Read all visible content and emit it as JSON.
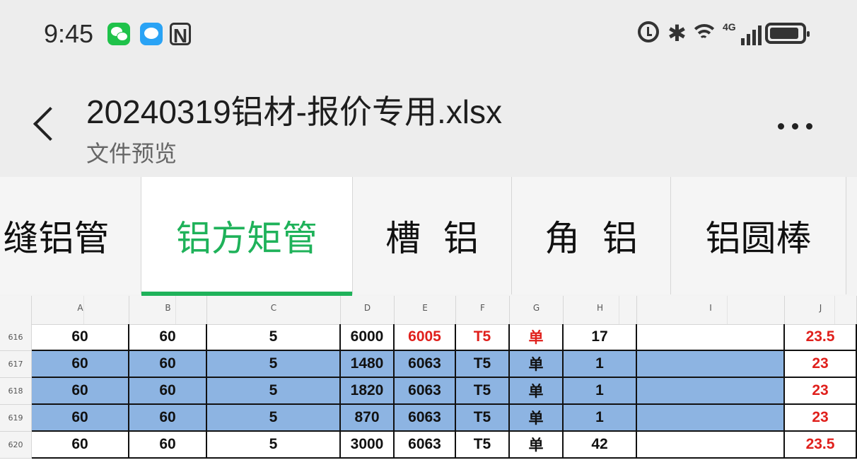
{
  "status_bar": {
    "time": "9:45",
    "network": "4G",
    "icons": [
      "wechat-icon",
      "message-icon",
      "nfc-icon",
      "alarm-icon",
      "bluetooth-icon",
      "wifi-icon",
      "signal-icon",
      "battery-icon"
    ]
  },
  "header": {
    "title": "20240319铝材-报价专用.xlsx",
    "subtitle": "文件预览"
  },
  "tabs": [
    {
      "label": "缝铝管",
      "active": false
    },
    {
      "label": "铝方矩管",
      "active": true
    },
    {
      "label": "槽  铝",
      "active": false
    },
    {
      "label": "角  铝",
      "active": false
    },
    {
      "label": "铝圆棒",
      "active": false
    }
  ],
  "sheet": {
    "columns": [
      "A",
      "B",
      "C",
      "D",
      "E",
      "F",
      "G",
      "H",
      "I",
      "J"
    ],
    "rows": [
      {
        "num": "616",
        "cells": [
          "60",
          "60",
          "5",
          "6000",
          "6005",
          "T5",
          "单",
          "17",
          "",
          "23.5"
        ],
        "highlight": false
      },
      {
        "num": "617",
        "cells": [
          "60",
          "60",
          "5",
          "1480",
          "6063",
          "T5",
          "单",
          "1",
          "",
          "23"
        ],
        "highlight": true
      },
      {
        "num": "618",
        "cells": [
          "60",
          "60",
          "5",
          "1820",
          "6063",
          "T5",
          "单",
          "1",
          "",
          "23"
        ],
        "highlight": true
      },
      {
        "num": "619",
        "cells": [
          "60",
          "60",
          "5",
          "870",
          "6063",
          "T5",
          "单",
          "1",
          "",
          "23"
        ],
        "highlight": true
      },
      {
        "num": "620",
        "cells": [
          "60",
          "60",
          "5",
          "3000",
          "6063",
          "T5",
          "单",
          "42",
          "",
          "23.5"
        ],
        "highlight": false
      }
    ]
  },
  "colors": {
    "accent": "#1fb25a",
    "highlight_fill": "#8db4e2",
    "red_text": "#e0201c"
  }
}
